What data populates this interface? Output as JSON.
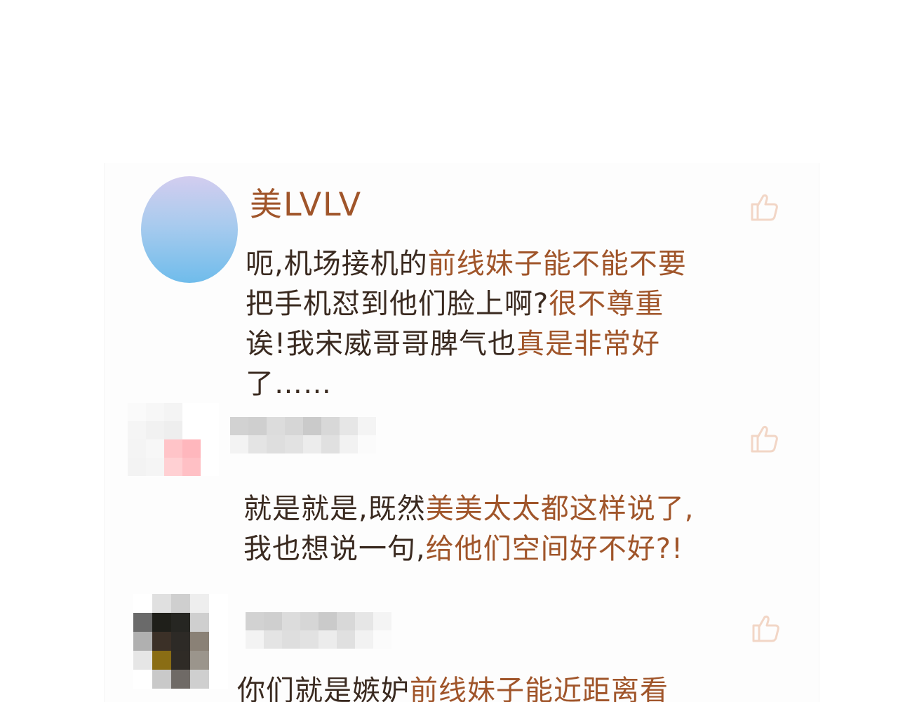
{
  "comments": [
    {
      "username": "美LVLV",
      "lines": [
        [
          {
            "t": "呃,机场接机的",
            "c": "#3a2a20"
          },
          {
            "t": "前线妹子能不能不要",
            "c": "#a0552a"
          }
        ],
        [
          {
            "t": "把手机怼到他们脸上啊?",
            "c": "#3a2a20"
          },
          {
            "t": "很不尊重",
            "c": "#a0552a"
          }
        ],
        [
          {
            "t": "诶!我宋威哥哥脾气也",
            "c": "#3a2a20"
          },
          {
            "t": "真是非常好",
            "c": "#a0552a"
          }
        ],
        [
          {
            "t": "了……",
            "c": "#3a2a20"
          }
        ]
      ]
    },
    {
      "username": "",
      "lines": [
        [
          {
            "t": "就是就是,既然",
            "c": "#3a2a20"
          },
          {
            "t": "美美太太都这样说了,",
            "c": "#a0552a"
          }
        ],
        [
          {
            "t": "我也想说一句,",
            "c": "#3a2a20"
          },
          {
            "t": "给他们空间好不好?!",
            "c": "#a0552a"
          }
        ]
      ]
    },
    {
      "username": "",
      "lines": [
        [
          {
            "t": "你们就是嫉妒",
            "c": "#3a2a20"
          },
          {
            "t": "前线妹子能近距离看",
            "c": "#a0552a"
          }
        ]
      ]
    }
  ],
  "icons": {
    "like": "thumbs-up-icon",
    "avatar": "avatar"
  },
  "colors": {
    "username": "#a0552a",
    "text_dark": "#3a2a20",
    "text_accent": "#a0552a",
    "like_icon": "#f2d6c6"
  }
}
